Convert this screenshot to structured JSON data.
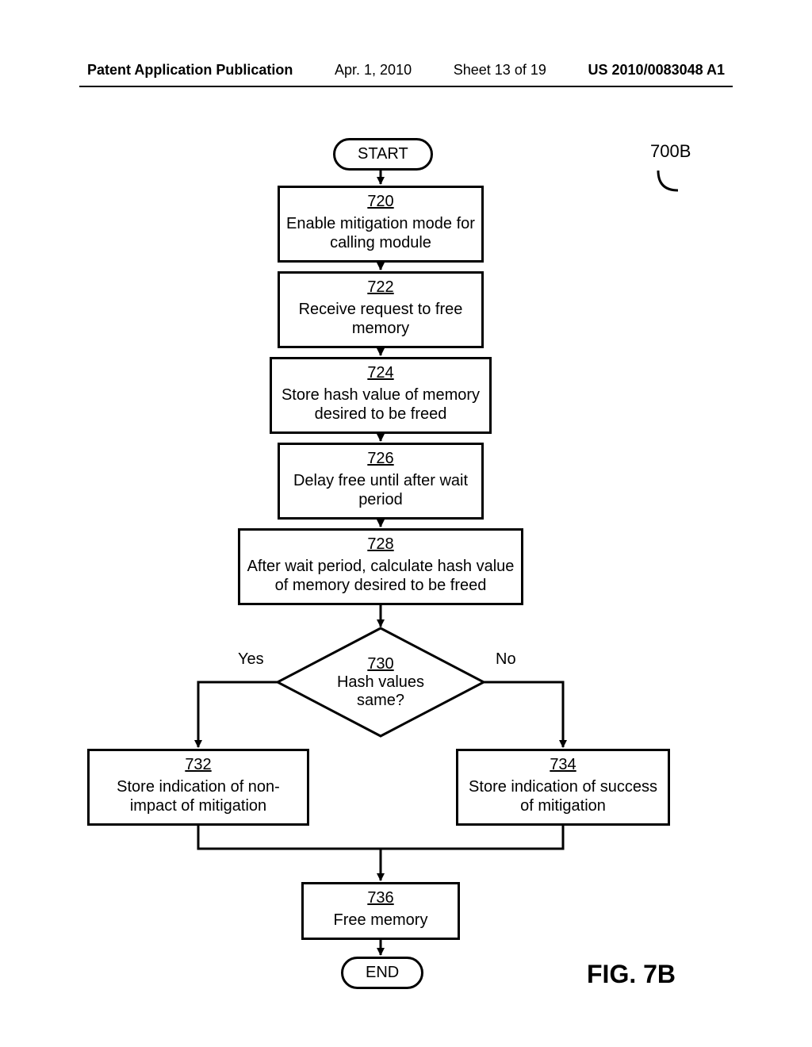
{
  "header": {
    "publication": "Patent Application Publication",
    "date": "Apr. 1, 2010",
    "sheet": "Sheet 13 of 19",
    "docno": "US 2010/0083048 A1"
  },
  "figure_ref": "700B",
  "figure_label": "FIG. 7B",
  "terminator": {
    "start": "START",
    "end": "END"
  },
  "boxes": {
    "b720": {
      "num": "720",
      "text": "Enable mitigation mode for calling module"
    },
    "b722": {
      "num": "722",
      "text": "Receive request to free memory"
    },
    "b724": {
      "num": "724",
      "text": "Store hash value of memory desired to be freed"
    },
    "b726": {
      "num": "726",
      "text": "Delay free until after wait period"
    },
    "b728": {
      "num": "728",
      "text": "After wait period, calculate hash value of memory desired to be freed"
    },
    "b730": {
      "num": "730",
      "text": "Hash values same?"
    },
    "b732": {
      "num": "732",
      "text": "Store indication of non-impact of mitigation"
    },
    "b734": {
      "num": "734",
      "text": "Store indication of success of mitigation"
    },
    "b736": {
      "num": "736",
      "text": "Free memory"
    }
  },
  "decision_labels": {
    "yes": "Yes",
    "no": "No"
  },
  "chart_data": {
    "type": "flowchart",
    "nodes": [
      {
        "id": "start",
        "type": "terminator",
        "label": "START"
      },
      {
        "id": "720",
        "type": "process",
        "label": "Enable mitigation mode for calling module"
      },
      {
        "id": "722",
        "type": "process",
        "label": "Receive request to free memory"
      },
      {
        "id": "724",
        "type": "process",
        "label": "Store hash value of memory desired to be freed"
      },
      {
        "id": "726",
        "type": "process",
        "label": "Delay free until after wait period"
      },
      {
        "id": "728",
        "type": "process",
        "label": "After wait period, calculate hash value of memory desired to be freed"
      },
      {
        "id": "730",
        "type": "decision",
        "label": "Hash values same?"
      },
      {
        "id": "732",
        "type": "process",
        "label": "Store indication of non-impact of mitigation"
      },
      {
        "id": "734",
        "type": "process",
        "label": "Store indication of success of mitigation"
      },
      {
        "id": "736",
        "type": "process",
        "label": "Free memory"
      },
      {
        "id": "end",
        "type": "terminator",
        "label": "END"
      }
    ],
    "edges": [
      {
        "from": "start",
        "to": "720"
      },
      {
        "from": "720",
        "to": "722"
      },
      {
        "from": "722",
        "to": "724"
      },
      {
        "from": "724",
        "to": "726"
      },
      {
        "from": "726",
        "to": "728"
      },
      {
        "from": "728",
        "to": "730"
      },
      {
        "from": "730",
        "to": "732",
        "label": "Yes"
      },
      {
        "from": "730",
        "to": "734",
        "label": "No"
      },
      {
        "from": "732",
        "to": "736"
      },
      {
        "from": "734",
        "to": "736"
      },
      {
        "from": "736",
        "to": "end"
      }
    ],
    "figure_reference": "700B"
  }
}
